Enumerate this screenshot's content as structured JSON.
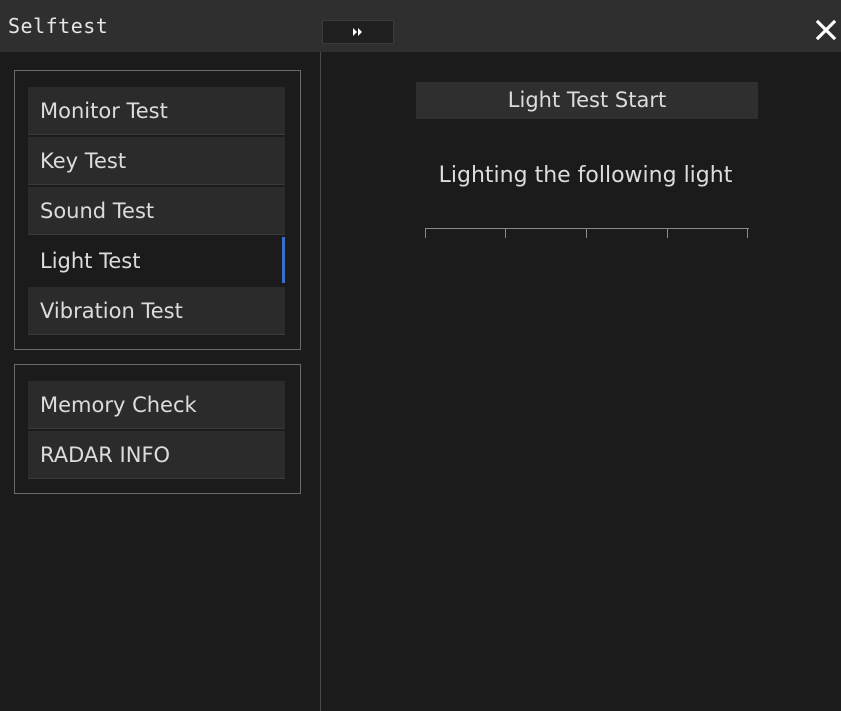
{
  "window": {
    "title": "Selftest",
    "expand_icon": "double-right-arrow-icon",
    "close_icon": "close-icon"
  },
  "sidebar": {
    "group_test": [
      {
        "label": "Monitor Test",
        "active": false
      },
      {
        "label": "Key Test",
        "active": false
      },
      {
        "label": "Sound Test",
        "active": false
      },
      {
        "label": "Light Test",
        "active": true
      },
      {
        "label": "Vibration Test",
        "active": false
      }
    ],
    "group_info": [
      {
        "label": "Memory Check"
      },
      {
        "label": "RADAR INFO"
      }
    ]
  },
  "main": {
    "start_button_label": "Light Test Start",
    "status_text": "Lighting the following light"
  },
  "colors": {
    "background": "#1b1b1b",
    "title_bar": "#2f2f2f",
    "button": "#2b2b2b",
    "accent": "#3a6fc8",
    "text": "#dcdcdc"
  }
}
